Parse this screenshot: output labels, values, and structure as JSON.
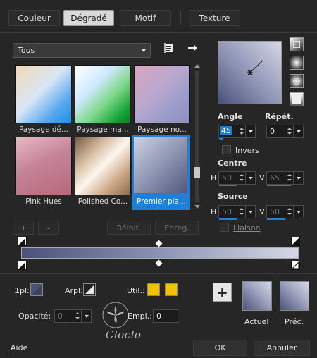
{
  "tabs": [
    {
      "label": "Couleur",
      "active": false
    },
    {
      "label": "Dégradé",
      "active": true
    },
    {
      "label": "Motif",
      "active": false
    },
    {
      "label": "Texture",
      "active": false
    }
  ],
  "category": {
    "selected": "Tous"
  },
  "thumbnails": [
    {
      "label": "Paysage dé...",
      "gradient": "linear-gradient(135deg,#f3d7b2 0%,#d9e7f6 45%,#5aa9ef 75%,#1a8fe6 100%)"
    },
    {
      "label": "Paysage ma...",
      "gradient": "linear-gradient(135deg,#ffffff 0%,#cfe8ff 35%,#7fd88a 60%,#15a33a 85%,#0d7d2a 100%)"
    },
    {
      "label": "Paysage no...",
      "gradient": "linear-gradient(135deg,#d9a7bf 0%,#b8a7cf 45%,#9d9dcc 70%,#8e8fc0 100%)"
    },
    {
      "label": "Pink Hues",
      "gradient": "linear-gradient(155deg,#e8b8c4 0%,#c58397 45%,#b8687b 100%)"
    },
    {
      "label": "Polished Co...",
      "gradient": "linear-gradient(135deg,#7a5a3f 0%,#d8c0a5 30%,#fdf6ee 50%,#cba987 75%,#8a6a4a 100%)"
    },
    {
      "label": "Premier pla...",
      "gradient": "linear-gradient(135deg,#cdd2e2 0%,#9097b3 50%,#4f577e 100%)"
    }
  ],
  "preview": {
    "gradient": "linear-gradient(45deg,#4a527a 0%,#8d93b3 45%,#d5d8e6 100%)"
  },
  "angle": {
    "label": "Angle",
    "value": "45"
  },
  "repeat": {
    "label": "Répét.",
    "value": "0"
  },
  "invert": {
    "label": "Invers"
  },
  "center": {
    "label": "Centre",
    "h_label": "H",
    "h_value": "50",
    "v_label": "V",
    "v_value": "65"
  },
  "source": {
    "label": "Source",
    "h_label": "H",
    "h_value": "50",
    "v_label": "V",
    "v_value": "50"
  },
  "link": {
    "label": "Liaison"
  },
  "buttons": {
    "plus": "+",
    "minus": "-",
    "reset": "Réinit.",
    "save": "Enreg."
  },
  "gradient_bar": {
    "gradient": "linear-gradient(90deg,#4a527a 0%,#8d93b3 50%,#d5d8e6 100%)"
  },
  "bottom": {
    "one_pl_label": "1pl:",
    "arpl_label": "Arpl:",
    "util_label": "Util.:",
    "opacity_label": "Opacité:",
    "opacity_value": "0",
    "empl_label": "Empl.:",
    "empl_value": "0",
    "add_label": "+",
    "current_label": "Actuel",
    "prev_label": "Préc.",
    "swatch_current": "linear-gradient(45deg,#4a527a 0%,#a3a8c3 60%,#d5d8e6 100%)",
    "swatch_prev": "linear-gradient(45deg,#4a527a 0%,#a3a8c3 60%,#d5d8e6 100%)",
    "util_color": "#f2c100"
  },
  "footer": {
    "help": "Aide",
    "ok": "OK",
    "cancel": "Annuler"
  },
  "watermark": {
    "text": "Cloclo"
  },
  "colors": {
    "accent": "#1f7fd6",
    "background": "#262626"
  }
}
